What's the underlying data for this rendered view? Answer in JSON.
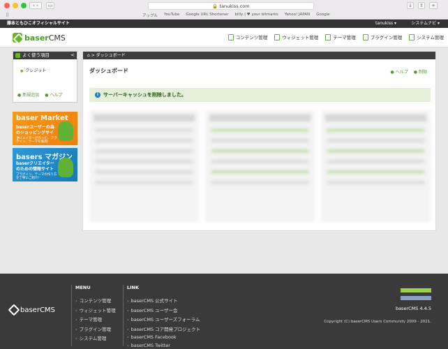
{
  "browser": {
    "url": "tanukiss.com",
    "bookmarks": [
      "アップル",
      "YouTube",
      "Google URL Shortener",
      "bitly | ♥ your bitmarks",
      "Yahoo! JAPAN",
      "Google"
    ]
  },
  "site": {
    "site_name": "藤本ともひこオフィシャルサイト",
    "user_menu": "tanukiss ▾",
    "system_navi": "システムナビ ▾",
    "logo_prefix": "baser",
    "logo_suffix": "CMS"
  },
  "topnav": [
    {
      "label": "コンテンツ管理",
      "icon": "contents-icon"
    },
    {
      "label": "ウィジェット管理",
      "icon": "widget-icon"
    },
    {
      "label": "テーマ管理",
      "icon": "theme-icon"
    },
    {
      "label": "プラグイン管理",
      "icon": "plugin-icon"
    },
    {
      "label": "システム管理",
      "icon": "system-icon"
    }
  ],
  "favorites": {
    "title": "よく使う項目",
    "toggle": "<",
    "items": [
      "クレジット"
    ],
    "add_label": "新規追加",
    "help_label": "ヘルプ"
  },
  "banners": {
    "market": {
      "title": "baser Market",
      "subtitle": "baserユーザーの為のショッピングサイト",
      "note": "クリエイターが作った、プラグイン、テーマを販売!"
    },
    "magazine": {
      "title": "basers マガジン",
      "subtitle": "baserクリエイターのための情報サイト",
      "note": "プラグイン、テーマの作り方を丁寧にご紹介!"
    }
  },
  "main": {
    "breadcrumb": "⌂ > ダッシュボード",
    "title": "ダッシュボード",
    "help": "ヘルプ",
    "settings": "制限",
    "alert": "サーバーキャッシュを削除しました。",
    "alert_icon": "i"
  },
  "footer": {
    "logo": "baserCMS",
    "menu_title": "MENU",
    "menu_items": [
      "コンテンツ管理",
      "ウィジェット管理",
      "テーマ管理",
      "プラグイン管理",
      "システム管理"
    ],
    "link_title": "LINK",
    "link_items": [
      "baserCMS 公式サイト",
      "baserCMS ユーザー会",
      "baserCMS ユーザーズフォーラム",
      "baserCMS コア開発プロジェクト",
      "baserCMS Facebook",
      "baserCMS Twitter"
    ],
    "version": "baserCMS 4.4.5",
    "copyright": "Copyright (C) baserCMS Users Community 2009 - 2021."
  }
}
